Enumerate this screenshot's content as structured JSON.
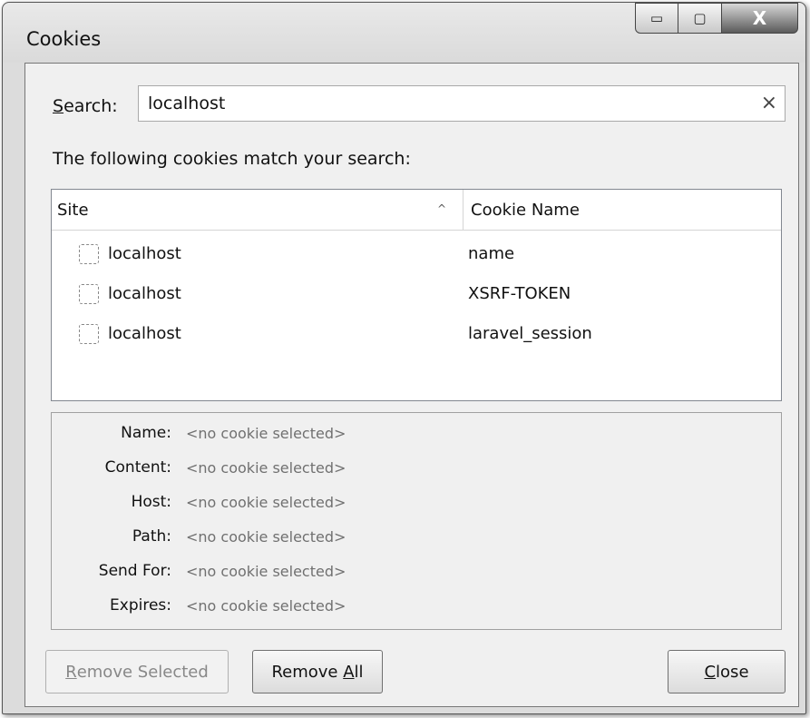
{
  "window": {
    "title": "Cookies",
    "controls": {
      "minimize": "▭",
      "maximize": "▢",
      "close": "X"
    }
  },
  "search": {
    "label_underlined": "S",
    "label_rest": "earch:",
    "value": "localhost",
    "clear": "×"
  },
  "match_text": "The following cookies match your search:",
  "table": {
    "columns": {
      "site": "Site",
      "cookie_name": "Cookie Name",
      "sort": "^"
    },
    "rows": [
      {
        "site": "localhost",
        "cookie_name": "name"
      },
      {
        "site": "localhost",
        "cookie_name": "XSRF-TOKEN"
      },
      {
        "site": "localhost",
        "cookie_name": "laravel_session"
      }
    ]
  },
  "details": [
    {
      "label": "Name:",
      "value": "<no cookie selected>"
    },
    {
      "label": "Content:",
      "value": "<no cookie selected>"
    },
    {
      "label": "Host:",
      "value": "<no cookie selected>"
    },
    {
      "label": "Path:",
      "value": "<no cookie selected>"
    },
    {
      "label": "Send For:",
      "value": "<no cookie selected>"
    },
    {
      "label": "Expires:",
      "value": "<no cookie selected>"
    }
  ],
  "buttons": {
    "remove_selected": {
      "underlined": "R",
      "rest": "emove Selected"
    },
    "remove_all": {
      "before": "Remove ",
      "underlined": "A",
      "rest": "ll"
    },
    "close": {
      "underlined": "C",
      "rest": "lose"
    }
  }
}
